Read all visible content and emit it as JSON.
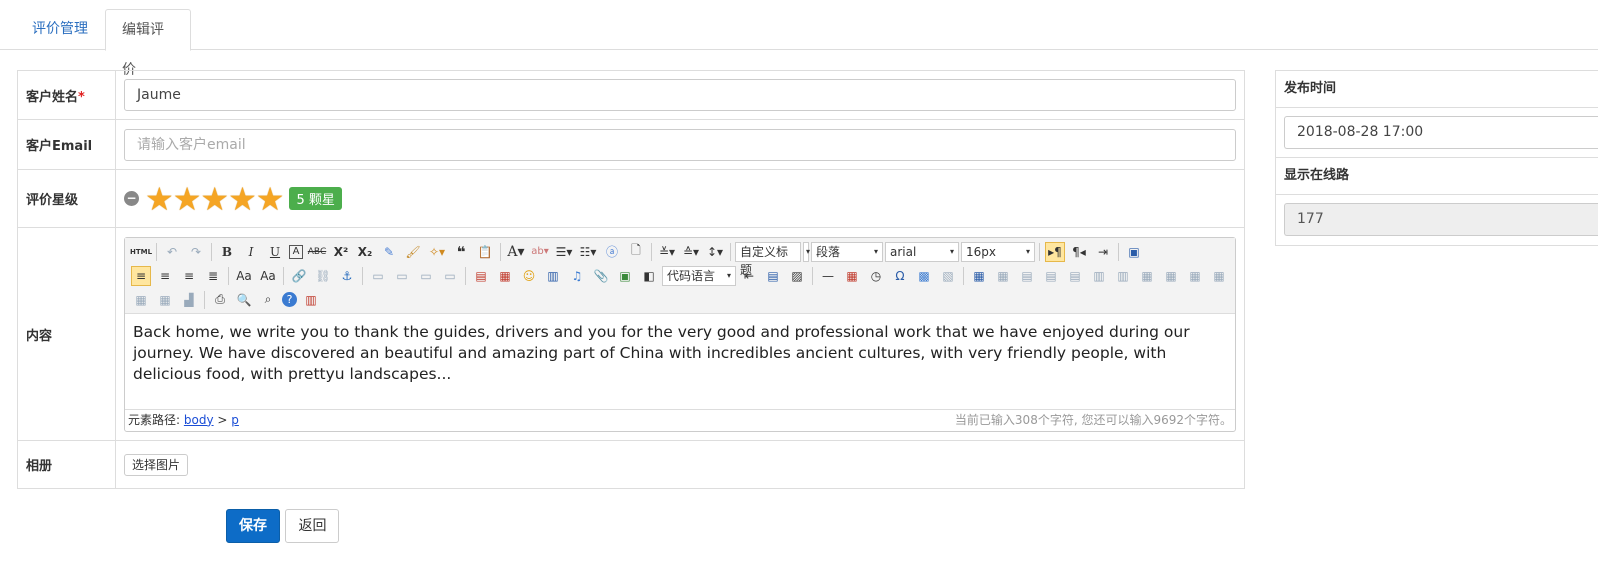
{
  "tabs": [
    {
      "label": "评价管理"
    },
    {
      "label": "编辑评价"
    }
  ],
  "form": {
    "name": {
      "label": "客户姓名",
      "required_mark": "*",
      "value": "Jaume"
    },
    "email": {
      "label": "客户Email",
      "placeholder": "请输入客户email",
      "value": ""
    },
    "rating": {
      "label": "评价星级",
      "stars": 5,
      "max_stars": 5,
      "badge": "5 颗星",
      "star_color": "#f5a524",
      "badge_color": "#4cae4c"
    },
    "content": {
      "label": "内容",
      "toolbar": {
        "heading_select": "自定义标题",
        "paragraph_select": "段落",
        "font_family_select": "arial",
        "font_size_select": "16px",
        "code_language_select": "代码语言"
      },
      "text": "Back home, we write you to thank the guides, drivers and you for the very good and professional work that we have enjoyed during our journey. We have discovered an beautiful and amazing part of China with incredibles ancient cultures, with very friendly people, with delicious food, with prettyu landscapes...",
      "path_label": "元素路径:",
      "path_body": "body",
      "path_sep": ">",
      "path_p": "p",
      "char_count": "当前已输入308个字符, 您还可以输入9692个字符。"
    },
    "album": {
      "label": "相册",
      "button": "选择图片"
    }
  },
  "actions": {
    "save": "保存",
    "back": "返回",
    "primary_color": "#0d6cc7"
  },
  "side": {
    "publish_time_label": "发布时间",
    "publish_time_value": "2018-08-28 17:00",
    "route_label": "显示在线路",
    "route_value": "177"
  }
}
